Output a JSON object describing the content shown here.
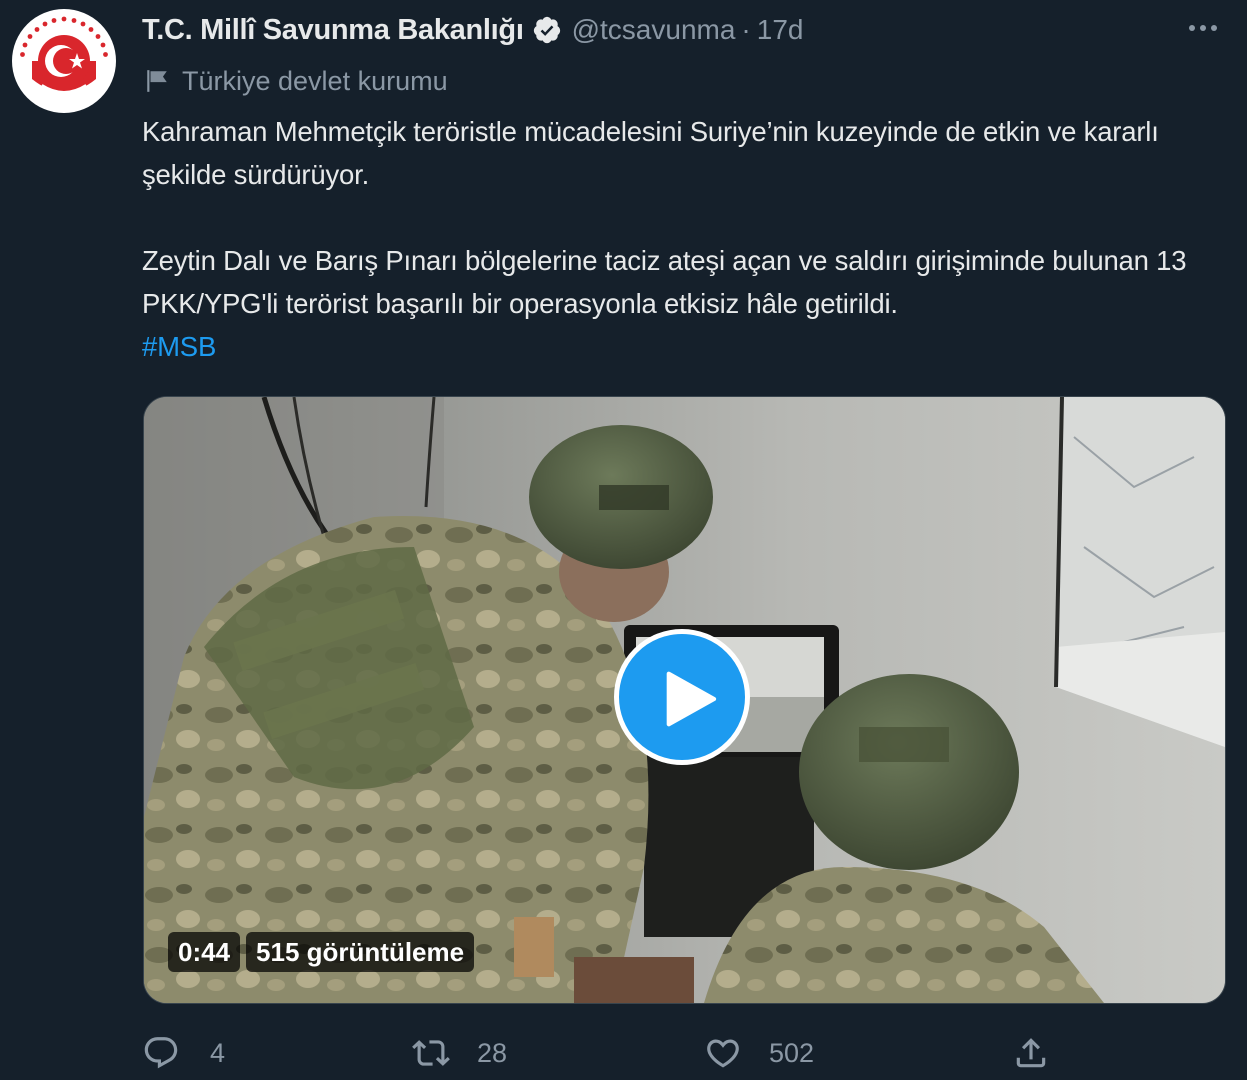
{
  "account": {
    "display_name": "T.C. Millî Savunma Bakanlığı",
    "handle": "@tcsavunma",
    "separator": "·",
    "time": "17d",
    "verified": true,
    "label": "Türkiye devlet kurumu"
  },
  "tweet": {
    "paragraph1": "Kahraman Mehmetçik teröristle mücadelesini Suriye’nin kuzeyinde de etkin ve kararlı şekilde sürdürüyor.",
    "paragraph2": "Zeytin Dalı ve Barış Pınarı bölgelerine taciz ateşi açan ve saldırı girişiminde bulunan 13 PKK/YPG'li terörist başarılı bir operasyonla etkisiz hâle getirildi.",
    "hashtag": "#MSB"
  },
  "media": {
    "type": "video",
    "duration": "0:44",
    "views": "515 görüntüleme"
  },
  "actions": {
    "reply_count": "4",
    "retweet_count": "28",
    "like_count": "502"
  },
  "icons": {
    "verified": "verified-badge-icon",
    "flag": "flag-icon",
    "more": "more-icon",
    "play": "play-icon",
    "reply": "reply-icon",
    "retweet": "retweet-icon",
    "like": "like-icon",
    "share": "share-icon"
  },
  "colors": {
    "background": "#15202b",
    "text": "#e7e9ea",
    "secondary": "#8b98a5",
    "accent": "#1d9bf0",
    "logo_red": "#d9262c"
  }
}
